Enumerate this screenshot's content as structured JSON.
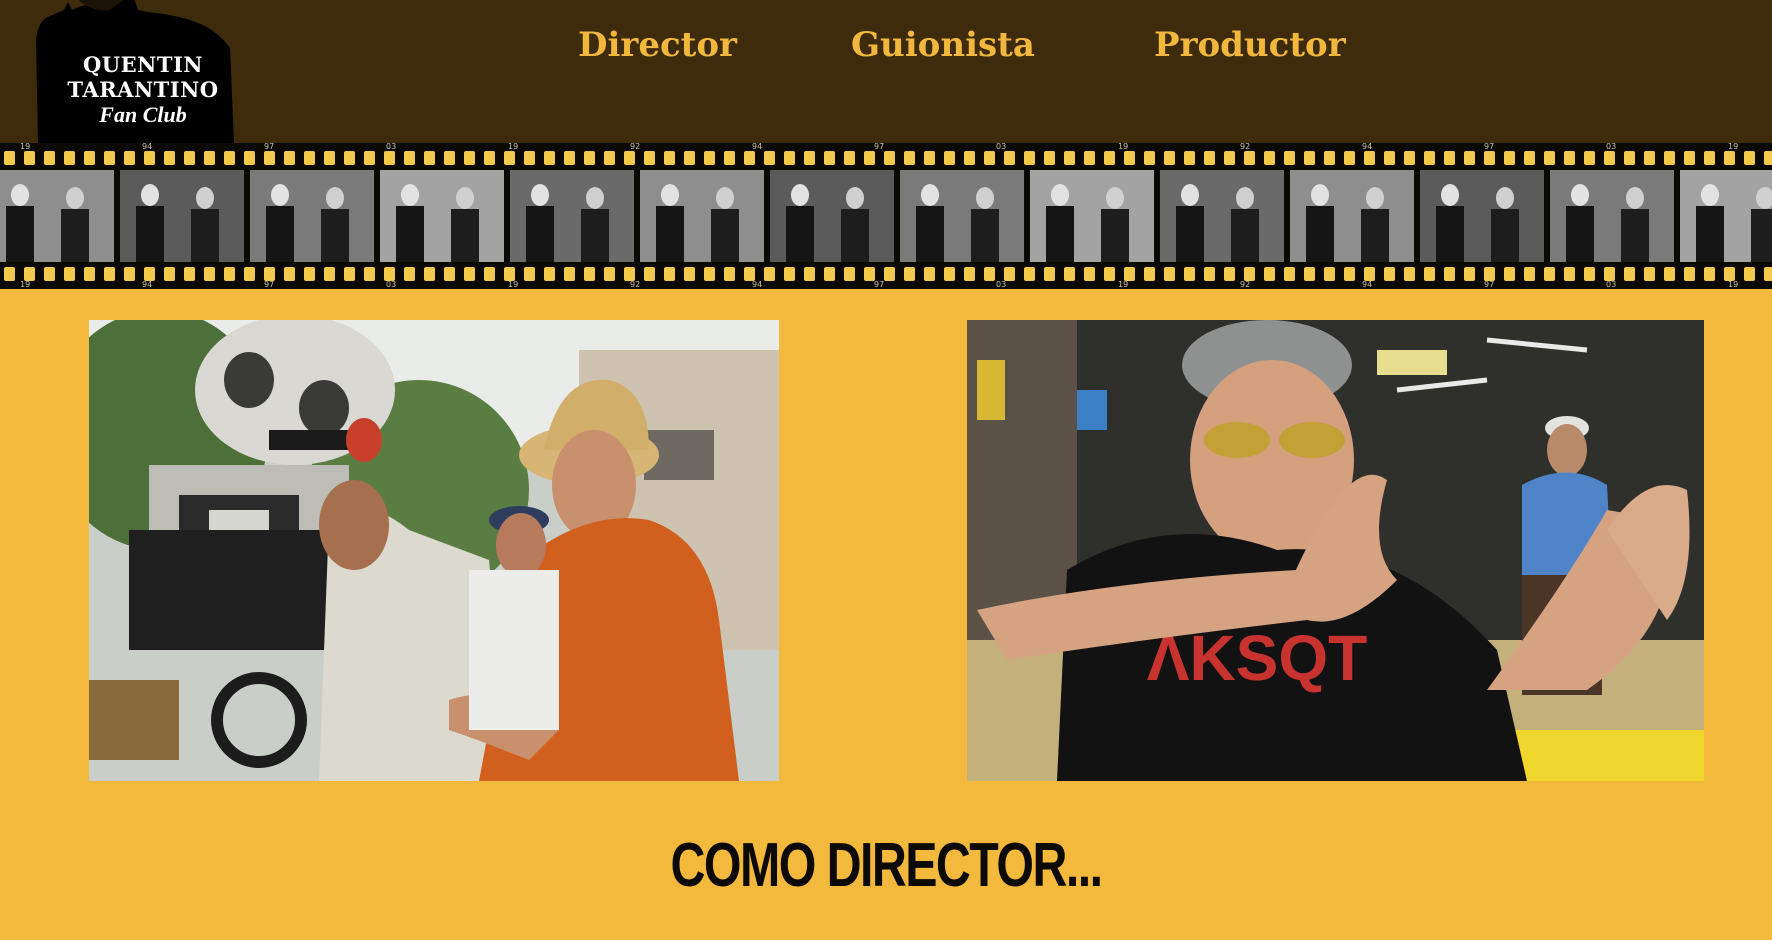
{
  "logo": {
    "line1": "Quentin",
    "line2": "Tarantino",
    "line3": "Fan Club"
  },
  "nav": {
    "items": [
      {
        "label": "Director"
      },
      {
        "label": "Guionista"
      },
      {
        "label": "Productor"
      }
    ]
  },
  "film_strip": {
    "frame_numbers": [
      "19",
      "94",
      "97",
      "03",
      "19",
      "92",
      "94",
      "97",
      "03",
      "19",
      "92",
      "94",
      "97",
      "03",
      "19"
    ]
  },
  "colors": {
    "header_bg": "#3d2b0b",
    "page_bg": "#f3b93c",
    "nav_text": "#f2b73d",
    "film_black": "#0b0904",
    "film_holes": "#f2c94a"
  },
  "section": {
    "title": "COMO DIRECTOR..."
  }
}
